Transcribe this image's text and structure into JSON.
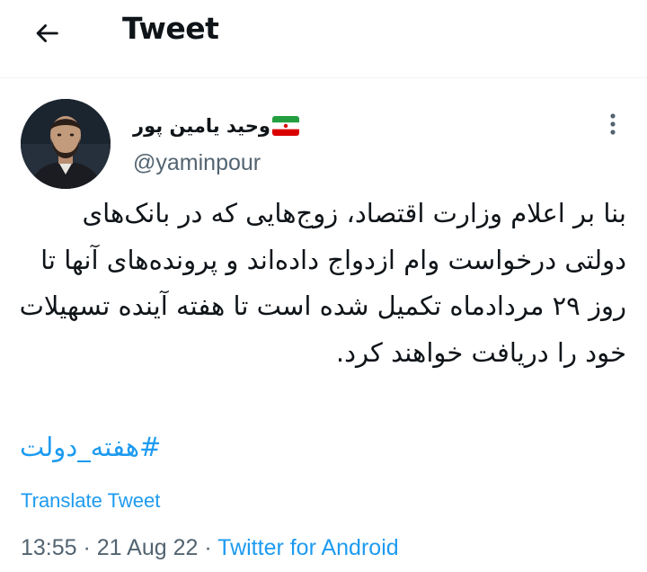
{
  "header": {
    "back_icon": "arrow-left-icon",
    "title": "Tweet"
  },
  "author": {
    "display_name": "وحید یامین پور",
    "flag_icon": "iran-flag-icon",
    "handle": "@yaminpour"
  },
  "more_icon": "vertical-dots-icon",
  "tweet": {
    "text": "بنا بر اعلام وزارت اقتصاد، زوج‌هایی که در بانک‌های دولتی درخواست وام ازدواج داده‌اند و پرونده‌های آنها تا روز ۲۹ مردادماه تکمیل شده است تا هفته آینده تسهیلات خود را دریافت خواهند کرد.",
    "hashtag": "#هفته_دولت"
  },
  "translate_label": "Translate Tweet",
  "meta": {
    "time": "13:55",
    "separator": " · ",
    "date": "21 Aug 22",
    "source": "Twitter for Android"
  },
  "colors": {
    "accent": "#1d9bf0",
    "text": "#0f1419",
    "secondary": "#536471",
    "divider": "#eff3f4"
  }
}
